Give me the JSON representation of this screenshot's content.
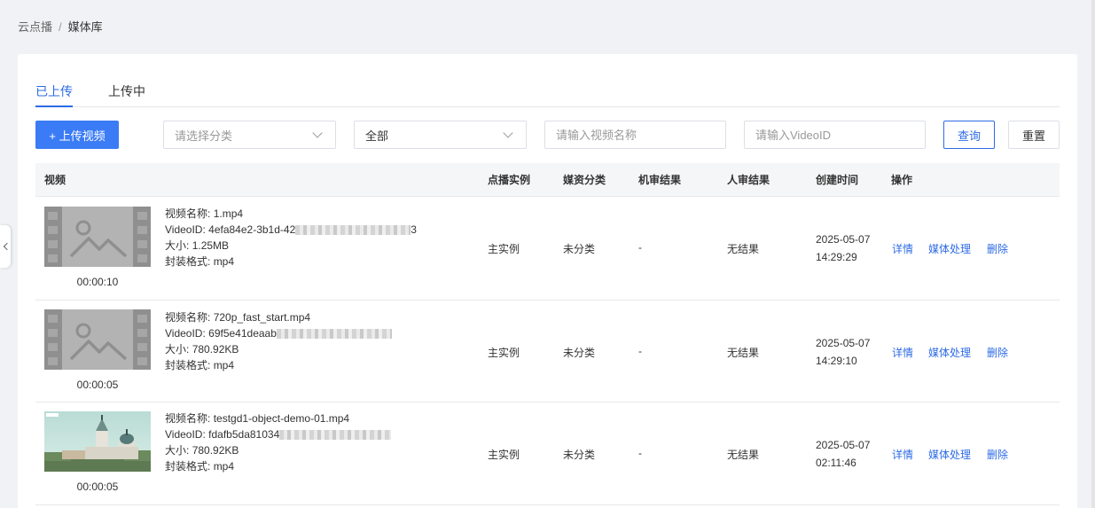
{
  "breadcrumb": {
    "root": "云点播",
    "separator": "/",
    "current": "媒体库"
  },
  "tabs": [
    {
      "label": "已上传",
      "active": true
    },
    {
      "label": "上传中",
      "active": false
    }
  ],
  "toolbar": {
    "upload_label": "+ 上传视频",
    "category_placeholder": "请选择分类",
    "status_value": "全部",
    "name_placeholder": "请输入视频名称",
    "videoid_placeholder": "请输入VideoID",
    "query_label": "查询",
    "reset_label": "重置"
  },
  "table": {
    "headers": [
      "视频",
      "点播实例",
      "媒资分类",
      "机审结果",
      "人审结果",
      "创建时间",
      "操作"
    ],
    "label_name": "视频名称:",
    "label_id": "VideoID:",
    "label_size": "大小:",
    "label_format": "封装格式:",
    "actions": [
      "详情",
      "媒体处理",
      "删除"
    ],
    "rows": [
      {
        "thumb": "placeholder",
        "duration": "00:00:10",
        "name": "1.mp4",
        "video_id": "4efa84e2-3b1d-42",
        "video_id_tail": "3",
        "size": "1.25MB",
        "format": "mp4",
        "instance": "主实例",
        "category": "未分类",
        "machine_review": "-",
        "human_review": "无结果",
        "date": "2025-05-07",
        "time": "14:29:29"
      },
      {
        "thumb": "placeholder",
        "duration": "00:00:05",
        "name": "720p_fast_start.mp4",
        "video_id": "69f5e41deaab",
        "video_id_tail": "",
        "size": "780.92KB",
        "format": "mp4",
        "instance": "主实例",
        "category": "未分类",
        "machine_review": "-",
        "human_review": "无结果",
        "date": "2025-05-07",
        "time": "14:29:10"
      },
      {
        "thumb": "photo",
        "duration": "00:00:05",
        "name": "testgd1-object-demo-01.mp4",
        "video_id": "fdafb5da81034",
        "video_id_tail": "",
        "size": "780.92KB",
        "format": "mp4",
        "instance": "主实例",
        "category": "未分类",
        "machine_review": "-",
        "human_review": "无结果",
        "date": "2025-05-07",
        "time": "02:11:46"
      }
    ]
  },
  "colors": {
    "primary": "#3b7cf6",
    "link": "#2d6be4",
    "background": "#f0f2f5"
  }
}
